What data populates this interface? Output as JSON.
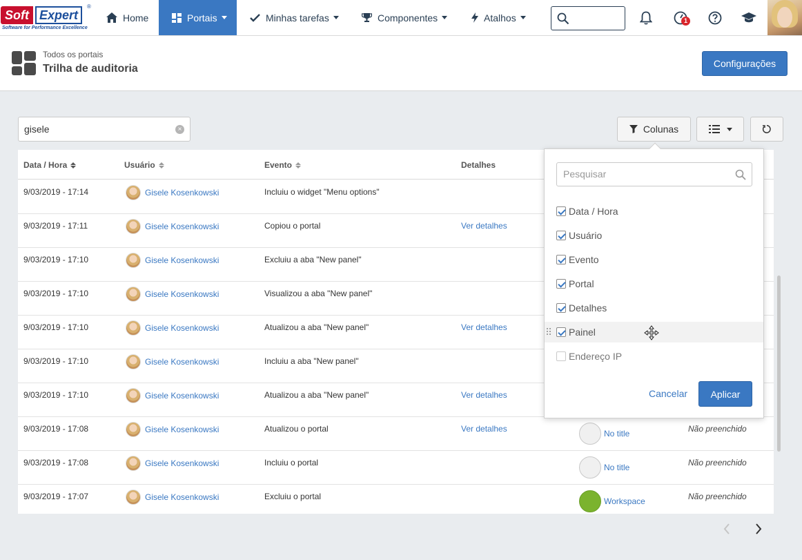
{
  "app": {
    "logo_soft": "Soft",
    "logo_expert": "Expert",
    "logo_reg": "®",
    "logo_tagline": "Software for Performance Excellence"
  },
  "nav": {
    "home": "Home",
    "portais": "Portais",
    "tarefas": "Minhas tarefas",
    "componentes": "Componentes",
    "atalhos": "Atalhos",
    "notification_badge": "1"
  },
  "header": {
    "breadcrumb": "Todos os portais",
    "title": "Trilha de auditoria",
    "config_button": "Configurações"
  },
  "filter": {
    "value": "gisele",
    "columns_button": "Colunas"
  },
  "table": {
    "columns": [
      "Data / Hora",
      "Usuário",
      "Evento",
      "Detalhes"
    ],
    "rows": [
      {
        "date": "9/03/2019 - 17:14",
        "user": "Gisele Kosenkowski",
        "event": "Incluiu o widget \"Menu options\"",
        "event_style": "normal",
        "details": "",
        "panel": "",
        "ip": ""
      },
      {
        "date": "9/03/2019 - 17:11",
        "user": "Gisele Kosenkowski",
        "event": "Copiou o portal",
        "event_style": "normal",
        "details": "Ver detalhes",
        "panel": "",
        "ip": ""
      },
      {
        "date": "9/03/2019 - 17:10",
        "user": "Gisele Kosenkowski",
        "event": "Excluiu a aba \"New panel\"",
        "event_style": "danger",
        "details": "",
        "panel": "",
        "ip": ""
      },
      {
        "date": "9/03/2019 - 17:10",
        "user": "Gisele Kosenkowski",
        "event": "Visualizou a aba \"New panel\"",
        "event_style": "normal",
        "details": "",
        "panel": "",
        "ip": ""
      },
      {
        "date": "9/03/2019 - 17:10",
        "user": "Gisele Kosenkowski",
        "event": "Atualizou a aba \"New panel\"",
        "event_style": "normal",
        "details": "Ver detalhes",
        "panel": "",
        "ip": ""
      },
      {
        "date": "9/03/2019 - 17:10",
        "user": "Gisele Kosenkowski",
        "event": "Incluiu a aba \"New panel\"",
        "event_style": "normal",
        "details": "",
        "panel": "",
        "ip": ""
      },
      {
        "date": "9/03/2019 - 17:10",
        "user": "Gisele Kosenkowski",
        "event": "Atualizou a aba \"New panel\"",
        "event_style": "normal",
        "details": "Ver detalhes",
        "panel": "",
        "ip": ""
      },
      {
        "date": "9/03/2019 - 17:08",
        "user": "Gisele Kosenkowski",
        "event": "Atualizou o portal",
        "event_style": "normal",
        "details": "Ver detalhes",
        "panel": "No title",
        "panel_icon": "grey",
        "ip": "Não preenchido"
      },
      {
        "date": "9/03/2019 - 17:08",
        "user": "Gisele Kosenkowski",
        "event": "Incluiu o portal",
        "event_style": "normal",
        "details": "",
        "panel": "No title",
        "panel_icon": "grey",
        "ip": "Não preenchido"
      },
      {
        "date": "9/03/2019 - 17:07",
        "user": "Gisele Kosenkowski",
        "event": "Excluiu o portal",
        "event_style": "danger",
        "details": "",
        "panel": "Workspace",
        "panel_icon": "green",
        "ip": "Não preenchido"
      }
    ]
  },
  "columns_popover": {
    "search_placeholder": "Pesquisar",
    "options": [
      {
        "label": "Data / Hora",
        "checked": true
      },
      {
        "label": "Usuário",
        "checked": true
      },
      {
        "label": "Evento",
        "checked": true
      },
      {
        "label": "Portal",
        "checked": true
      },
      {
        "label": "Detalhes",
        "checked": true
      },
      {
        "label": "Painel",
        "checked": true
      },
      {
        "label": "Endereço IP",
        "checked": false
      }
    ],
    "cancel": "Cancelar",
    "apply": "Aplicar"
  },
  "colors": {
    "primary": "#3a78c2",
    "danger": "#d9262c",
    "nav_text": "#2a3f54"
  }
}
